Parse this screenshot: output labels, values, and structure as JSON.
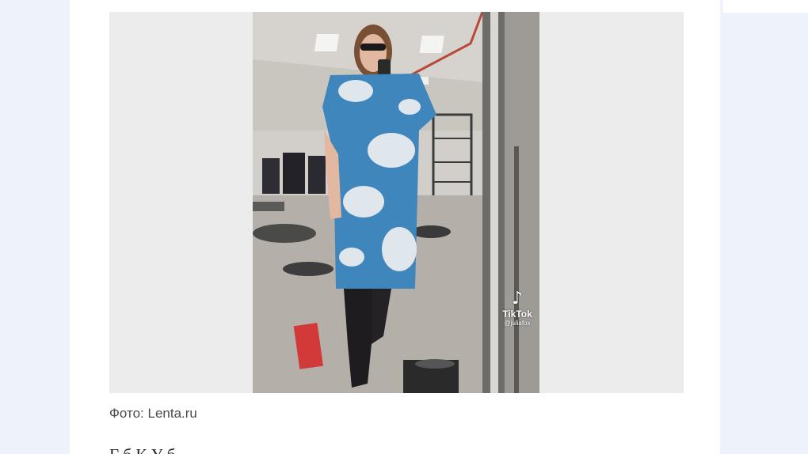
{
  "article": {
    "photo_caption": "Фото: Lenta.ru",
    "body_text_partial": "Г                   б                     К      У            б"
  },
  "video_overlay": {
    "brand": "TikTok",
    "handle": "@juliafox",
    "icon": "tiktok-note-icon"
  },
  "colors": {
    "page_background": "#eef3fb",
    "article_background": "#ffffff",
    "media_frame": "#ececec",
    "caption_text": "#4a4a4a",
    "dress_blue": "#3f86bd"
  }
}
